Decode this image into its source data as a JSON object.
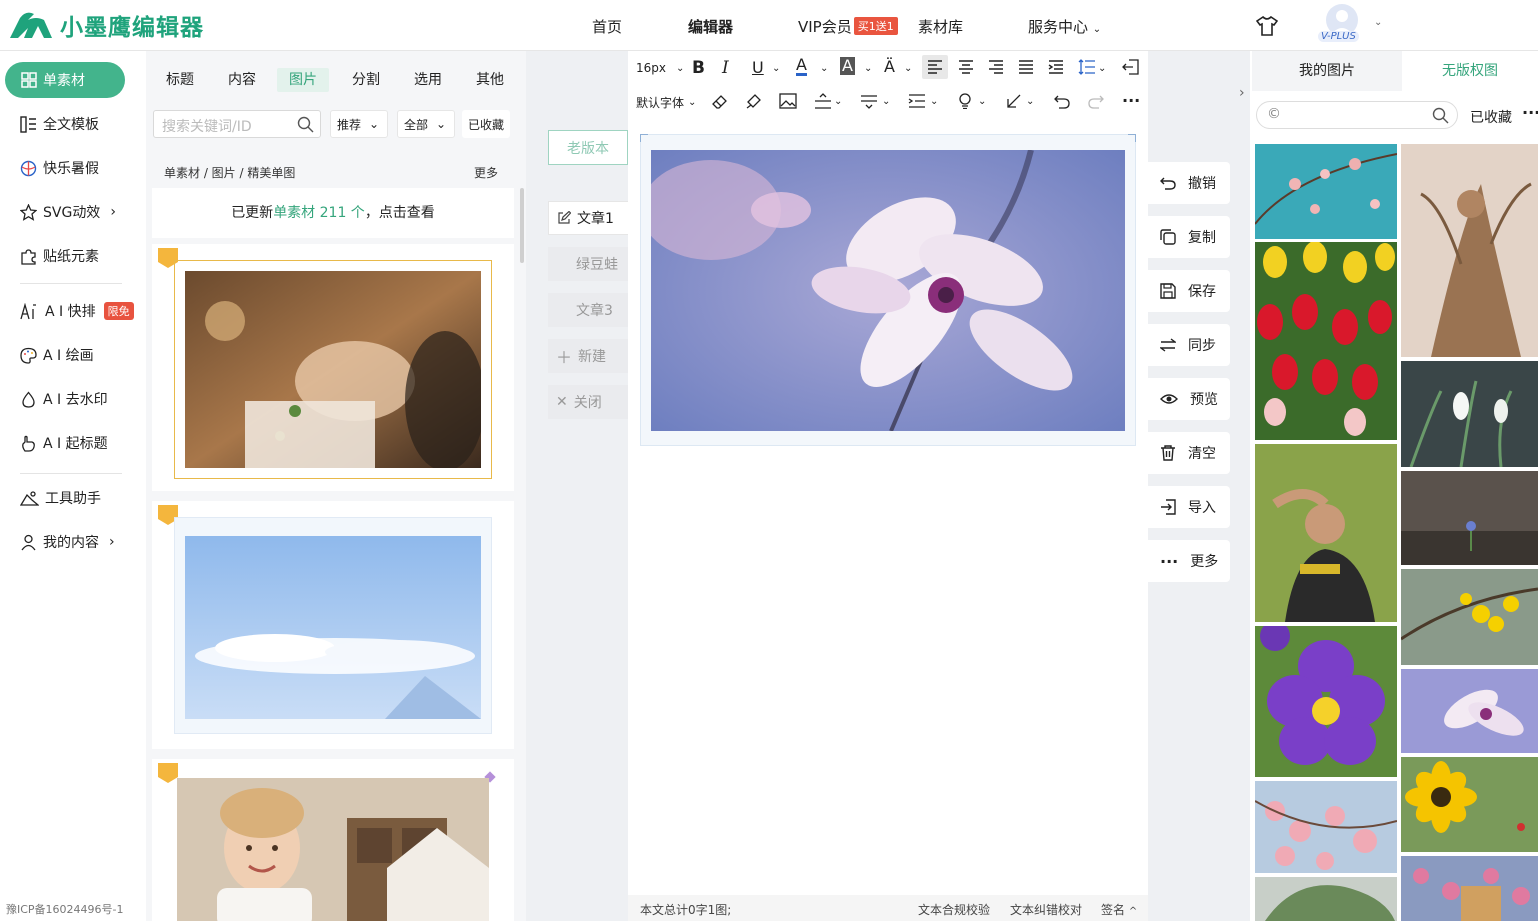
{
  "app": {
    "name": "小墨鹰编辑器",
    "brand_color": "#1fa37c"
  },
  "nav": {
    "home": "首页",
    "editor": "编辑器",
    "vip": "VIP会员",
    "vip_badge": "买1送1",
    "library": "素材库",
    "service": "服务中心",
    "vplus": "V-PLUS"
  },
  "sidebar": {
    "active": "单素材",
    "items": [
      "全文模板",
      "快乐暑假",
      "SVG动效",
      "贴纸元素",
      "A I 快排",
      "A I 绘画",
      "A I 去水印",
      "A I 起标题",
      "工具助手",
      "我的内容"
    ],
    "ai_badge": "限免",
    "icp": "豫ICP备16024496号-1"
  },
  "material": {
    "tabs": [
      "标题",
      "内容",
      "图片",
      "分割",
      "选用",
      "其他"
    ],
    "active_tab": "图片",
    "search_placeholder": "搜索关键词/ID",
    "filter_recommend": "推荐",
    "filter_all": "全部",
    "collected": "已收藏",
    "breadcrumb": "单素材  /  图片  /  精美单图",
    "more": "更多",
    "notice_pre": "已更新",
    "notice_hl": "单素材 211 个",
    "notice_post": "，点击查看"
  },
  "articles": {
    "old_version": "老版本",
    "tabs": [
      "文章1",
      "绿豆蛙",
      "文章3"
    ],
    "new": "新建",
    "close": "关闭"
  },
  "editor": {
    "font_size": "16px",
    "font_family": "默认字体",
    "status": "本文总计0字1图;",
    "compliance": "文本合规校验",
    "proofread": "文本纠错校对",
    "signature": "签名"
  },
  "actions": [
    "撤销",
    "复制",
    "保存",
    "同步",
    "预览",
    "清空",
    "导入",
    "更多"
  ],
  "right_panel": {
    "tab_mine": "我的图片",
    "tab_free": "无版权图",
    "collected": "已收藏"
  }
}
